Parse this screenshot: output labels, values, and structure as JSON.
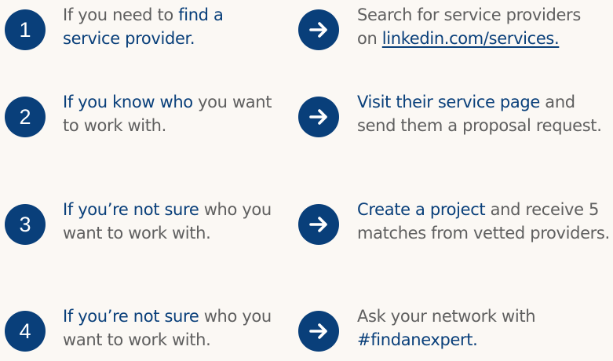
{
  "colors": {
    "background": "#fbf8f4",
    "accent": "#093f7a",
    "text": "#5f5f5f"
  },
  "rows": [
    {
      "number": "1",
      "left": {
        "line1_plain_before": "If you need to ",
        "line1_highlight": "find a",
        "line2_highlight": "service provider."
      },
      "arrow_icon": "arrow-right-icon",
      "right": {
        "line1": "Search for service providers",
        "line2_plain": "on ",
        "line2_link": "linkedin.com/services."
      }
    },
    {
      "number": "2",
      "left": {
        "line1_highlight": "If you know who",
        "line1_plain_after": " you want",
        "line2_plain": "to work with."
      },
      "arrow_icon": "arrow-right-icon",
      "right": {
        "line1_highlight": "Visit their service page",
        "line1_plain_after": " and",
        "line2": "send them a proposal request."
      }
    },
    {
      "number": "3",
      "left": {
        "line1_highlight": "If you’re not sure",
        "line1_plain_after": " who you",
        "line2_plain": "want to work with."
      },
      "arrow_icon": "arrow-right-icon",
      "right": {
        "line1_highlight": "Create a project",
        "line1_plain_after": " and receive 5",
        "line2": "matches from vetted providers."
      }
    },
    {
      "number": "4",
      "left": {
        "line1_highlight": "If you’re not sure",
        "line1_plain_after": " who you",
        "line2_plain": "want to work with."
      },
      "arrow_icon": "arrow-right-icon",
      "right": {
        "line1": "Ask your network with",
        "line2_highlight": "#findanexpert."
      }
    }
  ]
}
